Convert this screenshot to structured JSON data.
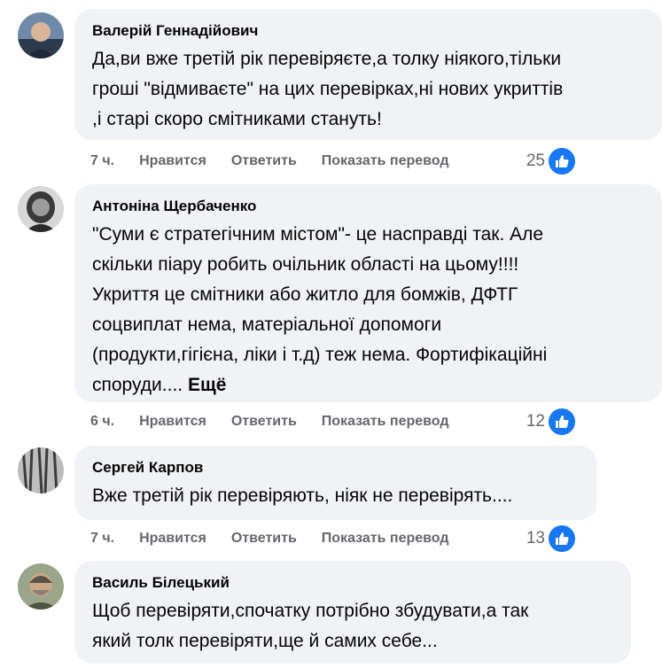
{
  "comments": [
    {
      "author": "Валерій Геннадійович",
      "text": "Да,ви вже третій рік перевіряєте,а толку ніякого,тільки\nгроші \"відмиваєте\" на цих перевірках,ні нових укриттів\n,і старі скоро смітниками стануть!",
      "more": "",
      "time": "7 ч.",
      "reactions": "25"
    },
    {
      "author": "Антоніна Щербаченко",
      "text": "\"Суми є стратегічним містом\"- це насправді так. Але\nскільки піару робить очільник області на цьому!!!!\nУкриття це смітники або житло для бомжів, ДФТГ\nсоцвиплат нема, матеріальної допомоги\n(продукти,гігієна, ліки і т.д) теж нема. Фортифікаційні\nспоруди....",
      "more": "Ещё",
      "time": "6 ч.",
      "reactions": "12"
    },
    {
      "author": "Сергей Карпов",
      "text": "Вже третій рік перевіряють, ніяк не перевірять....",
      "more": "",
      "time": "7 ч.",
      "reactions": "13"
    },
    {
      "author": "Василь Білецький",
      "text": "Щоб перевіряти,спочатку потрібно збудувати,а так\nякий толк перевіряти,ще й самих себе...",
      "more": ""
    }
  ],
  "actions": {
    "like": "Нравится",
    "reply": "Ответить",
    "translate": "Показать перевод"
  },
  "colors": {
    "bubble": "#f0f2f5",
    "like_badge": "#1877f2",
    "meta_text": "#65676b"
  }
}
